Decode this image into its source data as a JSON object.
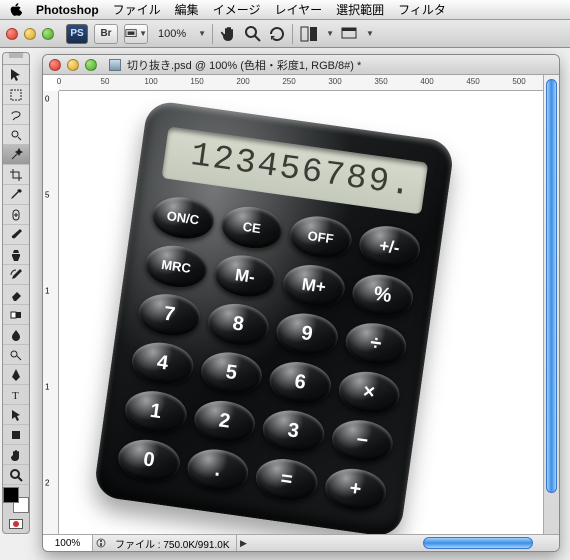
{
  "menubar": {
    "app_name": "Photoshop",
    "items": [
      "ファイル",
      "編集",
      "イメージ",
      "レイヤー",
      "選択範囲",
      "フィルタ"
    ]
  },
  "app_toolbar": {
    "ps_label": "PS",
    "br_label": "Br",
    "zoom_label": "100%"
  },
  "doc": {
    "title": "切り抜き.psd @ 100% (色相・彩度1, RGB/8#) *",
    "status_zoom": "100%",
    "status_text": "ファイル : 750.0K/991.0K",
    "ruler_h": [
      "0",
      "50",
      "100",
      "150",
      "200",
      "250",
      "300",
      "350",
      "400",
      "450",
      "500"
    ],
    "ruler_v": [
      "0",
      "5",
      "1",
      "1",
      "2"
    ]
  },
  "calculator": {
    "display": "123456789.",
    "keys": [
      {
        "label": "ON/C",
        "cls": "small"
      },
      {
        "label": "CE",
        "cls": "small"
      },
      {
        "label": "OFF",
        "cls": "small"
      },
      {
        "label": "+/-",
        "cls": "mid"
      },
      {
        "label": "MRC",
        "cls": "small"
      },
      {
        "label": "M-",
        "cls": "mid"
      },
      {
        "label": "M+",
        "cls": "mid"
      },
      {
        "label": "%",
        "cls": ""
      },
      {
        "label": "7",
        "cls": ""
      },
      {
        "label": "8",
        "cls": ""
      },
      {
        "label": "9",
        "cls": ""
      },
      {
        "label": "÷",
        "cls": ""
      },
      {
        "label": "4",
        "cls": ""
      },
      {
        "label": "5",
        "cls": ""
      },
      {
        "label": "6",
        "cls": ""
      },
      {
        "label": "×",
        "cls": ""
      },
      {
        "label": "1",
        "cls": ""
      },
      {
        "label": "2",
        "cls": ""
      },
      {
        "label": "3",
        "cls": ""
      },
      {
        "label": "−",
        "cls": ""
      },
      {
        "label": "0",
        "cls": ""
      },
      {
        "label": ".",
        "cls": ""
      },
      {
        "label": "=",
        "cls": ""
      },
      {
        "label": "+",
        "cls": ""
      }
    ]
  },
  "tools": [
    "move",
    "marquee",
    "lasso",
    "quickselect",
    "magicwand",
    "crop",
    "eyedropper",
    "healing",
    "brush",
    "clone",
    "history",
    "eraser",
    "gradient",
    "blur",
    "dodge",
    "pen",
    "type",
    "path",
    "shape",
    "hand",
    "zoom"
  ]
}
